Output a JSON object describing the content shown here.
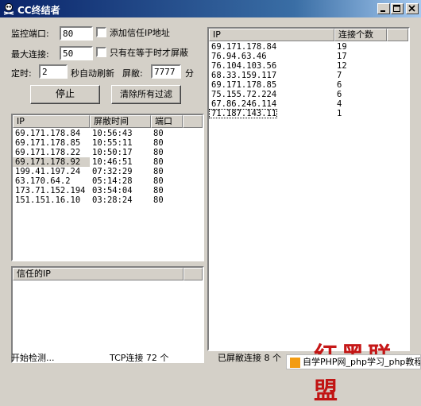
{
  "window": {
    "title": "CC终结者"
  },
  "settings": {
    "port_label": "监控端口:",
    "port_value": "80",
    "trust_label": "添加信任IP地址",
    "maxconn_label": "最大连接:",
    "maxconn_value": "50",
    "only_equal_label": "只有在等于时才屏蔽",
    "timer_label": "定时:",
    "timer_value": "2",
    "refresh_label": "秒自动刷新",
    "block_label": "屏敝:",
    "block_value": "7777",
    "minutes_label": "分"
  },
  "buttons": {
    "stop": "停止",
    "clear": "清除所有过滤"
  },
  "blocked_list": {
    "headers": [
      "IP",
      "屏敝时间",
      "端口"
    ],
    "rows": [
      [
        "69.171.178.84",
        "10:56:43",
        "80"
      ],
      [
        "69.171.178.85",
        "10:55:11",
        "80"
      ],
      [
        "69.171.178.22",
        "10:50:17",
        "80"
      ],
      [
        "69.171.178.92",
        "10:46:51",
        "80"
      ],
      [
        "199.41.197.24",
        "07:32:29",
        "80"
      ],
      [
        "63.170.64.2",
        "05:14:28",
        "80"
      ],
      [
        "173.71.152.194",
        "03:54:04",
        "80"
      ],
      [
        "151.151.16.10",
        "03:28:24",
        "80"
      ]
    ]
  },
  "trusted_list": {
    "header": "信任的IP"
  },
  "connections_list": {
    "headers": [
      "IP",
      "连接个数"
    ],
    "rows": [
      [
        "69.171.178.84",
        "19"
      ],
      [
        "76.94.63.46",
        "17"
      ],
      [
        "76.104.103.56",
        "12"
      ],
      [
        "68.33.159.117",
        "7"
      ],
      [
        "69.171.178.85",
        "6"
      ],
      [
        "75.155.72.224",
        "6"
      ],
      [
        "67.86.246.114",
        "4"
      ],
      [
        "71.187.143.11",
        "1"
      ]
    ]
  },
  "status": {
    "left": "开始检测...",
    "tcp": "TCP连接 72 个",
    "blocked": "已屏敝连接 8 个"
  },
  "watermark": {
    "logo_text": "红黑联盟",
    "site_text": "自学PHP网_php学习_php教程"
  }
}
